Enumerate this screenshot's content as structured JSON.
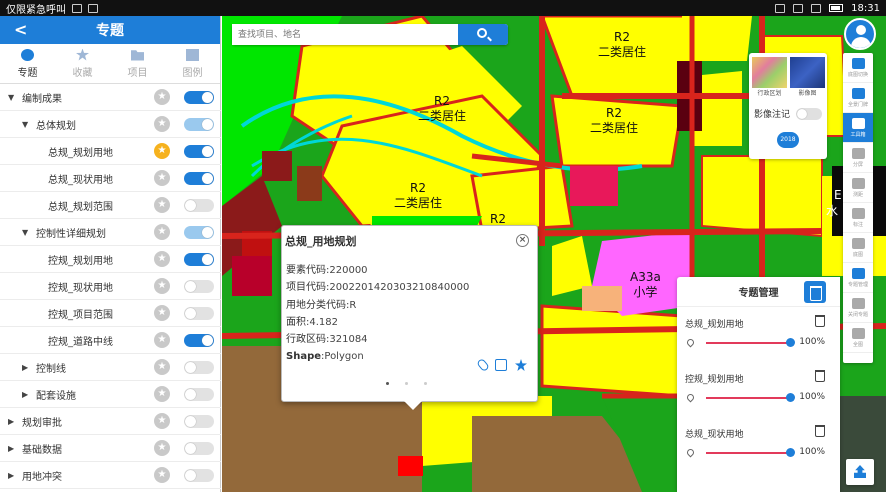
{
  "statusbar": {
    "carrier": "仅限紧急呼叫",
    "time": "18:31"
  },
  "panel": {
    "title": "专题",
    "tabs": [
      {
        "label": "专题",
        "icon": "compass-icon",
        "active": true
      },
      {
        "label": "收藏",
        "icon": "star-icon",
        "active": false
      },
      {
        "label": "项目",
        "icon": "folder-icon",
        "active": false
      },
      {
        "label": "图例",
        "icon": "legend-icon",
        "active": false
      }
    ],
    "tree": [
      {
        "label": "编制成果",
        "level": 0,
        "expanded": true,
        "starred": false,
        "toggle": "on"
      },
      {
        "label": "总体规划",
        "level": 1,
        "expanded": true,
        "starred": false,
        "toggle": "mid"
      },
      {
        "label": "总规_规划用地",
        "level": 2,
        "starred": true,
        "toggle": "on"
      },
      {
        "label": "总规_现状用地",
        "level": 2,
        "starred": false,
        "toggle": "on"
      },
      {
        "label": "总规_规划范围",
        "level": 2,
        "starred": false,
        "toggle": "off"
      },
      {
        "label": "控制性详细规划",
        "level": 1,
        "expanded": true,
        "starred": false,
        "toggle": "mid"
      },
      {
        "label": "控规_规划用地",
        "level": 2,
        "starred": false,
        "toggle": "on"
      },
      {
        "label": "控规_现状用地",
        "level": 2,
        "starred": false,
        "toggle": "off"
      },
      {
        "label": "控规_项目范围",
        "level": 2,
        "starred": false,
        "toggle": "off"
      },
      {
        "label": "控规_道路中线",
        "level": 2,
        "starred": false,
        "toggle": "on"
      },
      {
        "label": "控制线",
        "level": 1,
        "expanded": false,
        "starred": false,
        "toggle": "off"
      },
      {
        "label": "配套设施",
        "level": 1,
        "expanded": false,
        "starred": false,
        "toggle": "off"
      },
      {
        "label": "规划审批",
        "level": 0,
        "expanded": false,
        "starred": false,
        "toggle": "off"
      },
      {
        "label": "基础数据",
        "level": 0,
        "expanded": false,
        "starred": false,
        "toggle": "off"
      },
      {
        "label": "用地冲突",
        "level": 0,
        "expanded": false,
        "starred": false,
        "toggle": "off"
      }
    ]
  },
  "search": {
    "placeholder": "查找项目、地名"
  },
  "map": {
    "labels": [
      {
        "code": "R2",
        "name": "二类居住"
      },
      {
        "code": "R2",
        "name": "二类居住"
      },
      {
        "code": "R2",
        "name": "二类居住"
      },
      {
        "code": "R2",
        "name": "二类居住"
      },
      {
        "code": "A33a",
        "name": "小学"
      }
    ],
    "partial_labels": [
      "R2",
      "E",
      "水"
    ]
  },
  "popup": {
    "title": "总规_用地规划",
    "fields": [
      {
        "key": "要素代码",
        "value": "220000"
      },
      {
        "key": "项目代码",
        "value": "2002201420303210840000"
      },
      {
        "key": "用地分类代码",
        "value": "R"
      },
      {
        "key": "面积",
        "value": "4.182"
      },
      {
        "key": "行政区码",
        "value": "321084"
      },
      {
        "key": "Shape",
        "value": "Polygon"
      }
    ]
  },
  "layer_card": {
    "thumb_a": "行政区划",
    "thumb_b": "影像图",
    "note_label": "影像注记",
    "year": "2018"
  },
  "toolbar": {
    "items": [
      {
        "label": "底图切换",
        "icon": "layers-icon"
      },
      {
        "label": "全景门牌",
        "icon": "panorama-icon"
      },
      {
        "label": "工具箱",
        "icon": "toolbox-icon",
        "active": true
      },
      {
        "label": "分屏",
        "icon": "split-screen-icon"
      },
      {
        "label": "测距",
        "icon": "measure-icon"
      },
      {
        "label": "标注",
        "icon": "flag-icon"
      },
      {
        "label": "底图",
        "icon": "basemap-icon"
      },
      {
        "label": "专题管理",
        "icon": "topic-manage-icon",
        "active_blue": true
      },
      {
        "label": "关闭专题",
        "icon": "close-topic-icon"
      },
      {
        "label": "全图",
        "icon": "globe-icon"
      }
    ]
  },
  "manager": {
    "title": "专题管理",
    "items": [
      {
        "name": "总规_规划用地",
        "opacity": "100%"
      },
      {
        "name": "控规_规划用地",
        "opacity": "100%"
      },
      {
        "name": "总规_现状用地",
        "opacity": "100%"
      }
    ]
  },
  "colors": {
    "accent": "#1e7ed8",
    "residential": "#ffff00",
    "road": "#d8241c",
    "green": "#00e600",
    "school": "#ff66ff"
  }
}
